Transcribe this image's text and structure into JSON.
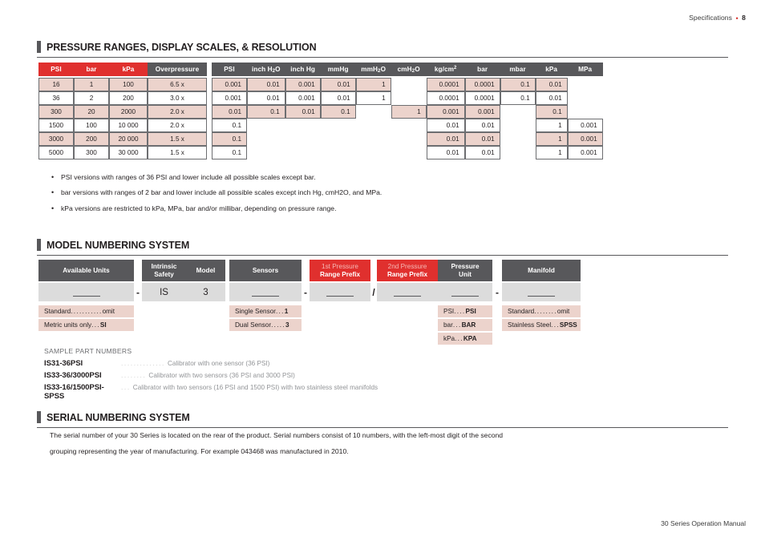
{
  "running_head": {
    "label": "Specifications",
    "separator": "•",
    "page": "8"
  },
  "running_foot": {
    "label": "30 Series Operation Manual"
  },
  "sections": {
    "pressure": {
      "title": "PRESSURE RANGES, DISPLAY SCALES, & RESOLUTION"
    },
    "model": {
      "title": "MODEL NUMBERING SYSTEM"
    },
    "serial": {
      "title": "SERIAL NUMBERING SYSTEM"
    }
  },
  "chart_data": {
    "type": "table",
    "title": "PRESSURE RANGES, DISPLAY SCALES, & RESOLUTION",
    "groups": [
      {
        "name": "ranges",
        "header_style": [
          "red",
          "red",
          "red",
          "gray"
        ],
        "headers": [
          "PSI",
          "bar",
          "kPa",
          "Overpressure"
        ],
        "rows": [
          [
            "16",
            "1",
            "100",
            "6.5 x"
          ],
          [
            "36",
            "2",
            "200",
            "3.0 x"
          ],
          [
            "300",
            "20",
            "2000",
            "2.0 x"
          ],
          [
            "1500",
            "100",
            "10 000",
            "2.0 x"
          ],
          [
            "3000",
            "200",
            "20 000",
            "1.5 x"
          ],
          [
            "5000",
            "300",
            "30 000",
            "1.5 x"
          ]
        ]
      },
      {
        "name": "resolution",
        "header_style": [
          "gray",
          "gray",
          "gray",
          "gray",
          "gray",
          "gray",
          "gray",
          "gray",
          "gray",
          "gray",
          "gray"
        ],
        "headers": [
          "PSI",
          "inch H2O",
          "inch Hg",
          "mmHg",
          "mmH2O",
          "cmH2O",
          "kg/cm2",
          "bar",
          "mbar",
          "kPa",
          "MPa"
        ],
        "rows": [
          [
            "0.001",
            "0.01",
            "0.001",
            "0.01",
            "1",
            "",
            "0.0001",
            "0.0001",
            "0.1",
            "0.01",
            ""
          ],
          [
            "0.001",
            "0.01",
            "0.001",
            "0.01",
            "1",
            "",
            "0.0001",
            "0.0001",
            "0.1",
            "0.01",
            ""
          ],
          [
            "0.01",
            "0.1",
            "0.01",
            "0.1",
            "",
            "1",
            "0.001",
            "0.001",
            "",
            "0.1",
            ""
          ],
          [
            "0.1",
            "",
            "",
            "",
            "",
            "",
            "0.01",
            "0.01",
            "",
            "1",
            "0.001"
          ],
          [
            "0.1",
            "",
            "",
            "",
            "",
            "",
            "0.01",
            "0.01",
            "",
            "1",
            "0.001"
          ],
          [
            "0.1",
            "",
            "",
            "",
            "",
            "",
            "0.01",
            "0.01",
            "",
            "1",
            "0.001"
          ]
        ]
      }
    ]
  },
  "range_notes": [
    "PSI versions with ranges of 36 PSI and lower include all possible scales except bar.",
    "bar versions with ranges of 2 bar and lower include all possible scales except inch Hg, cmH2O, and MPa.",
    "kPa versions are restricted to kPa, MPa, bar and/or millibar, depending on pressure range."
  ],
  "model_diagram": {
    "separators": [
      "-",
      "-",
      "/",
      "-"
    ],
    "fields": [
      {
        "head_line1": "Available Units",
        "head_line2": "",
        "style": "gray",
        "value": "",
        "options": [
          {
            "label": "Standard",
            "dots": "...........",
            "value": " omit",
            "bold": false
          },
          {
            "label": "Metric units only ",
            "dots": "...",
            "value": " SI",
            "bold": true
          }
        ]
      },
      {
        "head_line1": "Intrinsic",
        "head_line2": "Safety",
        "style": "gray",
        "value": "IS",
        "options": []
      },
      {
        "head_line1": "Model",
        "head_line2": "",
        "style": "gray",
        "value": "3",
        "options": []
      },
      {
        "head_line1": "Sensors",
        "head_line2": "",
        "style": "gray",
        "value": "",
        "options": [
          {
            "label": "Single Sensor ",
            "dots": "...",
            "value": "1",
            "bold": true
          },
          {
            "label": "Dual Sensor",
            "dots": ".....",
            "value": "3",
            "bold": true
          }
        ]
      },
      {
        "head_line1": "1st Pressure",
        "head_line2": "Range Prefix",
        "style": "red",
        "value": "",
        "options": []
      },
      {
        "head_line1": "2nd Pressure",
        "head_line2": "Range Prefix",
        "style": "red",
        "value": "",
        "options": []
      },
      {
        "head_line1": "Pressure",
        "head_line2": "Unit",
        "style": "gray",
        "value": "",
        "options": [
          {
            "label": "PSI",
            "dots": "....",
            "value": " PSI",
            "bold": true
          },
          {
            "label": "bar ",
            "dots": "...",
            "value": " BAR",
            "bold": true
          },
          {
            "label": "kPa ",
            "dots": "...",
            "value": " KPA",
            "bold": true
          }
        ]
      },
      {
        "head_line1": "Manifold",
        "head_line2": "",
        "style": "gray",
        "value": "",
        "options": [
          {
            "label": "Standard",
            "dots": "........",
            "value": "omit",
            "bold": false
          },
          {
            "label": "Stainless Steel",
            "dots": "...",
            "value": "SPSS",
            "bold": true
          }
        ]
      }
    ]
  },
  "sample_parts": {
    "title": "SAMPLE PART NUMBERS",
    "rows": [
      {
        "part": "IS31-36PSI",
        "dots": "..............",
        "desc": "Calibrator with one sensor (36 PSI)"
      },
      {
        "part": "IS33-36/3000PSI",
        "dots": "........",
        "desc": "Calibrator with two sensors (36 PSI and 3000 PSI)"
      },
      {
        "part": "IS33-16/1500PSI-SPSS",
        "dots": "...",
        "desc": "Calibrator with two sensors (16 PSI and 1500 PSI) with two stainless steel manifolds"
      }
    ]
  },
  "serial_body": [
    "The serial number of your 30 Series is located on the rear of the product. Serial numbers consist of 10 numbers, with the left-most digit of the second",
    "grouping representing the year of manufacturing. For example 043468 was manufactured in 2010."
  ],
  "colors": {
    "red": "#e0302e",
    "gray": "#58585b",
    "pink": "#ecd3cc",
    "field": "#dcdcdc"
  }
}
